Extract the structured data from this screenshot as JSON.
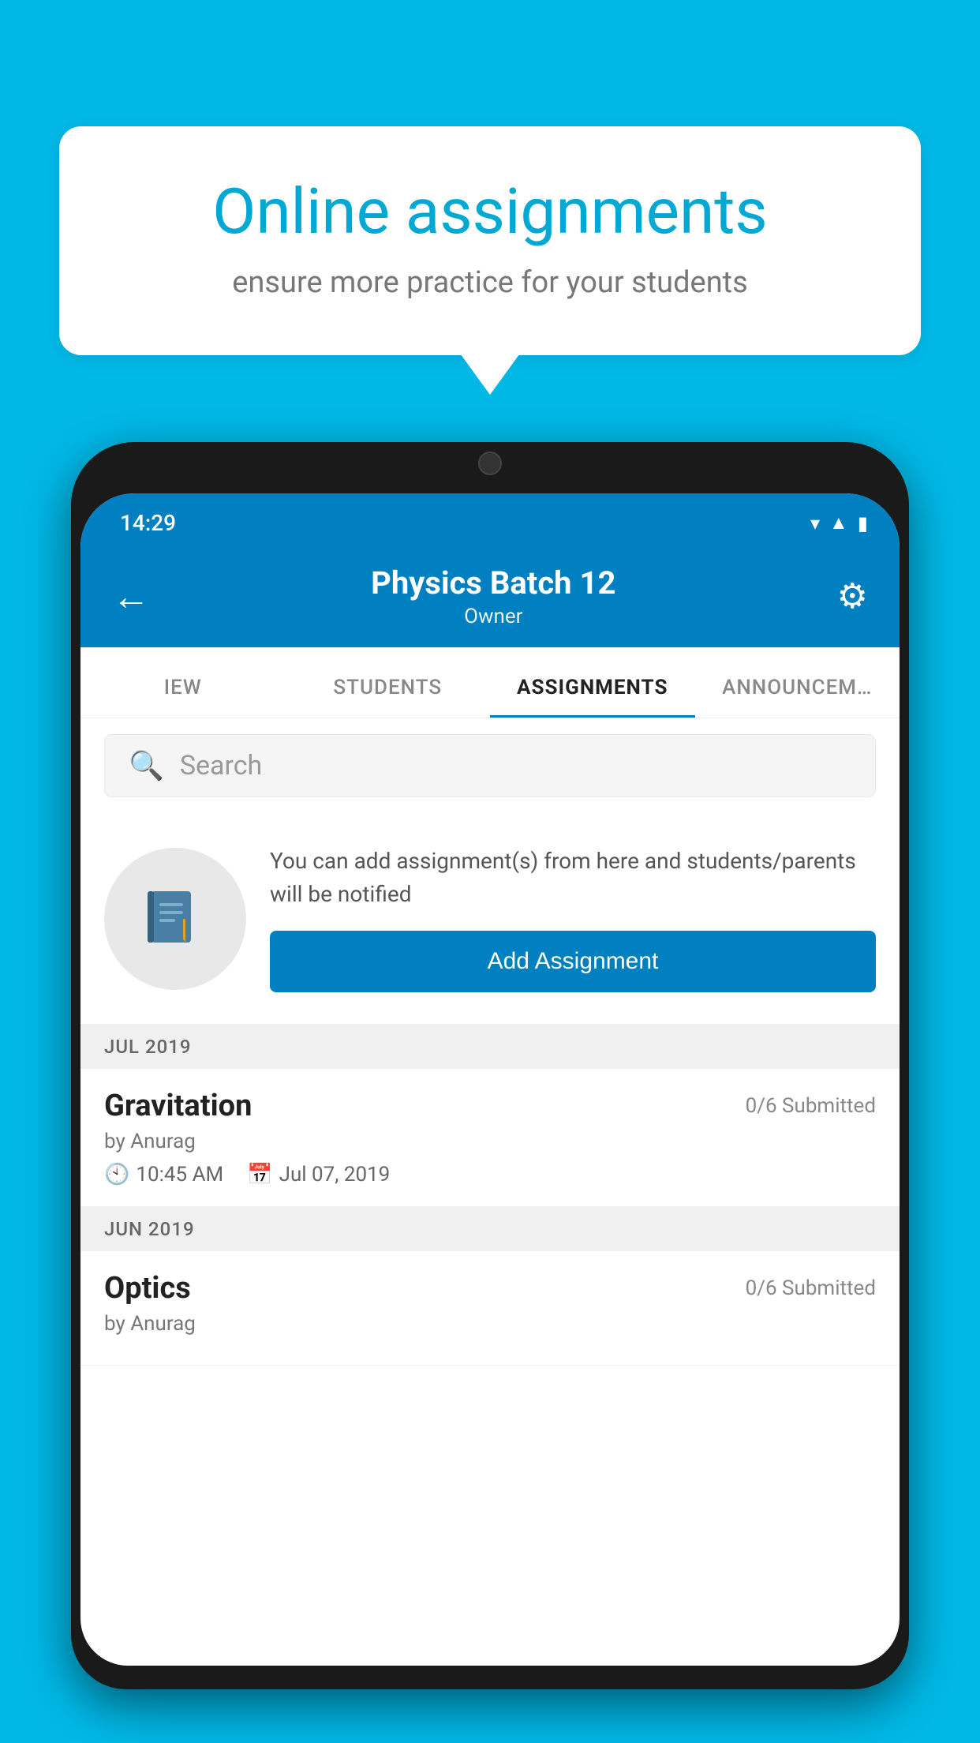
{
  "background_color": "#00b8e6",
  "bubble": {
    "title": "Online assignments",
    "subtitle": "ensure more practice for your students"
  },
  "phone": {
    "status_bar": {
      "time": "14:29"
    },
    "app_bar": {
      "title": "Physics Batch 12",
      "subtitle": "Owner",
      "back_label": "←",
      "settings_label": "⚙"
    },
    "tabs": [
      {
        "label": "IEW",
        "active": false
      },
      {
        "label": "STUDENTS",
        "active": false
      },
      {
        "label": "ASSIGNMENTS",
        "active": true
      },
      {
        "label": "ANNOUNCEM…",
        "active": false
      }
    ],
    "search": {
      "placeholder": "Search"
    },
    "add_section": {
      "description": "You can add assignment(s) from here and students/parents will be notified",
      "button_label": "Add Assignment"
    },
    "sections": [
      {
        "header": "JUL 2019",
        "assignments": [
          {
            "name": "Gravitation",
            "submitted": "0/6 Submitted",
            "author": "by Anurag",
            "time": "10:45 AM",
            "date": "Jul 07, 2019"
          }
        ]
      },
      {
        "header": "JUN 2019",
        "assignments": [
          {
            "name": "Optics",
            "submitted": "0/6 Submitted",
            "author": "by Anurag",
            "time": "",
            "date": ""
          }
        ]
      }
    ]
  }
}
